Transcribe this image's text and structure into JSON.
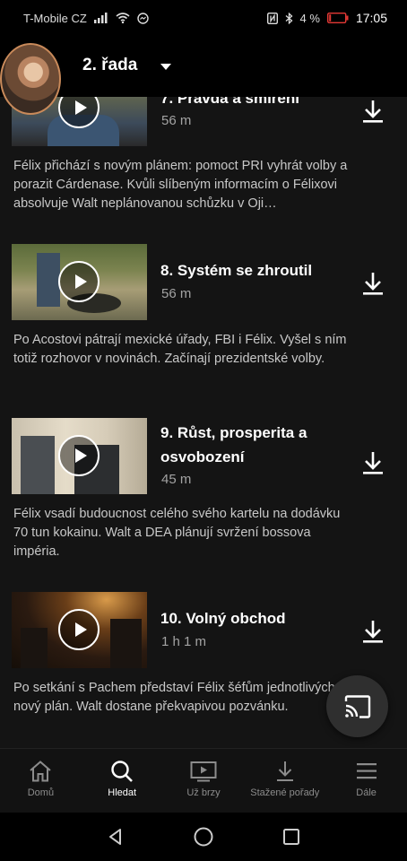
{
  "status": {
    "carrier": "T-Mobile CZ",
    "battery": "4 %",
    "time": "17:05"
  },
  "header": {
    "season": "2. řada"
  },
  "episodes": [
    {
      "title": "7. Pravda a smíření",
      "duration": "56 m",
      "description": "Félix přichází s novým plánem: pomoct PRI vyhrát volby a porazit Cárdenase. Kvůli slíbeným informacím o Félixovi absolvuje Walt neplánovanou schůzku v Oji…"
    },
    {
      "title": "8. Systém se zhroutil",
      "duration": "56 m",
      "description": "Po Acostovi pátrají mexické úřady, FBI i Félix. Vyšel s ním totiž rozhovor v novinách. Začínají prezidentské volby."
    },
    {
      "title": "9. Růst, prosperita a osvobození",
      "duration": "45 m",
      "description": "Félix vsadí budoucnost celého svého kartelu na dodávku 70 tun kokainu. Walt a DEA plánují svržení bossova impéria."
    },
    {
      "title": "10. Volný obchod",
      "duration": "1 h 1 m",
      "description": "Po setkání s Pachem představí Félix šéfům jednotlivých gangů nový plán. Walt dostane překvapivou pozvánku."
    }
  ],
  "nav": {
    "home": "Domů",
    "search": "Hledat",
    "coming_soon": "Už brzy",
    "downloads": "Stažené pořady",
    "more": "Dále"
  },
  "colors": {
    "background": "#141414",
    "muted_text": "#a3a3a3"
  }
}
